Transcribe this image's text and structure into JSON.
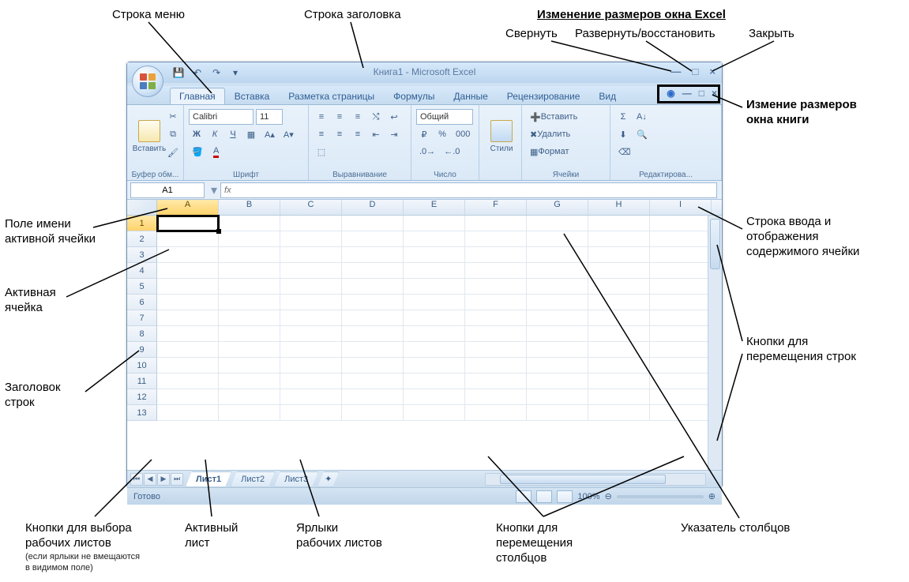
{
  "annotations": {
    "menu_row": "Строка меню",
    "title_row": "Строка заголовка",
    "resize_excel": "Изменение размеров окна Excel",
    "minimize": "Свернуть",
    "maximize": "Развернуть/восстановить",
    "close": "Закрыть",
    "resize_book": "Измение размеров\nокна книги",
    "name_box": "Поле имени\nактивной ячейки",
    "active_cell": "Активная\nячейка",
    "row_header": "Заголовок\nстрок",
    "formula_bar": "Строка ввода и\nотображения\nсодержимого ячейки",
    "vscroll": "Кнопки для\nперемещения строк",
    "hscroll": "Кнопки для\nперемещения\nстолбцов",
    "col_ptr": "Указатель столбцов",
    "sheet_nav": "Кнопки для выбора\nрабочих листов",
    "sheet_nav_note": "(если ярлыки не вмещаются\nв видимом поле)",
    "active_sheet": "Активный\nлист",
    "sheet_tabs": "Ярлыки\nрабочих листов"
  },
  "app": {
    "title": "Книга1 - Microsoft Excel",
    "tabs": [
      "Главная",
      "Вставка",
      "Разметка страницы",
      "Формулы",
      "Данные",
      "Рецензирование",
      "Вид"
    ],
    "groups": {
      "clipboard": "Буфер обм...",
      "paste": "Вставить",
      "font": "Шрифт",
      "font_name": "Calibri",
      "font_size": "11",
      "align": "Выравнивание",
      "number": "Число",
      "number_fmt": "Общий",
      "styles": "Стили",
      "cells": "Ячейки",
      "cells_insert": "Вставить",
      "cells_delete": "Удалить",
      "cells_format": "Формат",
      "editing": "Редактирова..."
    },
    "name_box": "A1",
    "columns": [
      "A",
      "B",
      "C",
      "D",
      "E",
      "F",
      "G",
      "H",
      "I"
    ],
    "rows": [
      "1",
      "2",
      "3",
      "4",
      "5",
      "6",
      "7",
      "8",
      "9",
      "10",
      "11",
      "12",
      "13"
    ],
    "sheets": [
      "Лист1",
      "Лист2",
      "Лист3"
    ],
    "status": "Готово",
    "zoom": "100%"
  }
}
